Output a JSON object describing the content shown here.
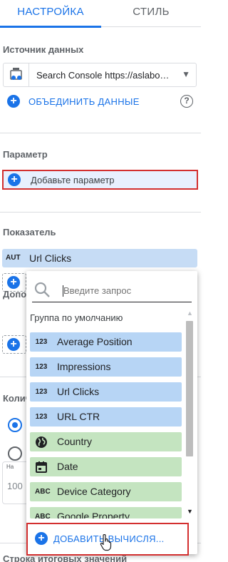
{
  "tabs": {
    "setup": "НАСТРОЙКА",
    "style": "СТИЛЬ"
  },
  "data_source": {
    "title": "Источник данных",
    "value": "Search Console https://aslabo…",
    "blend_label": "ОБЪЕДИНИТЬ ДАННЫЕ",
    "help": "?"
  },
  "parameter": {
    "title": "Параметр",
    "add_label": "Добавьте параметр"
  },
  "metric": {
    "title": "Показатель",
    "type_badge": "AUT",
    "value": "Url Clicks"
  },
  "partial_titles": {
    "additional": "Допол",
    "quantity": "Колич",
    "bottom": "Строка итоговых значений"
  },
  "number_box": {
    "tiny": "На",
    "value": "100"
  },
  "dropdown": {
    "search_placeholder": "Введите запрос",
    "group_label": "Группа по умолчанию",
    "fields": [
      {
        "icon": "123",
        "label": "Average Position",
        "kind": "metric"
      },
      {
        "icon": "123",
        "label": "Impressions",
        "kind": "metric"
      },
      {
        "icon": "123",
        "label": "Url Clicks",
        "kind": "metric"
      },
      {
        "icon": "123",
        "label": "URL CTR",
        "kind": "metric"
      },
      {
        "icon": "globe-icon",
        "label": "Country",
        "kind": "dimension"
      },
      {
        "icon": "calendar-icon",
        "label": "Date",
        "kind": "dimension"
      },
      {
        "icon": "ABC",
        "label": "Device Category",
        "kind": "dimension"
      },
      {
        "icon": "ABC",
        "label": "Google Property",
        "kind": "dimension"
      }
    ],
    "add_calc_label": "ДОБАВИТЬ ВЫЧИСЛЯ..."
  },
  "colors": {
    "accent": "#1a73e8",
    "metric_bg": "#b7d5f5",
    "dimension_bg": "#c4e4c0",
    "highlight_border": "#d32f2f"
  }
}
